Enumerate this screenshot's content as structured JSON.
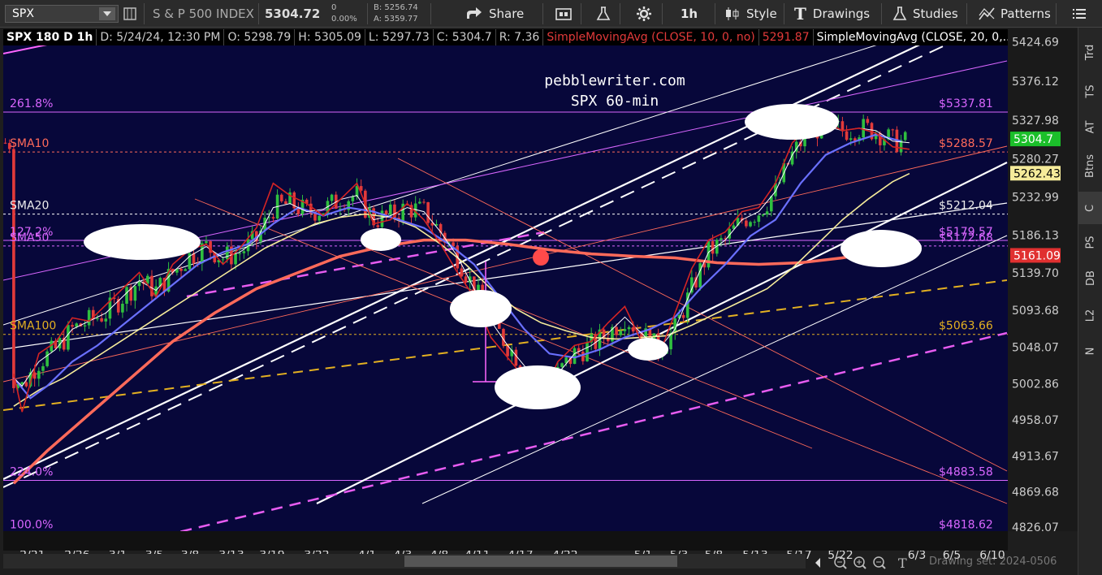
{
  "toolbar": {
    "symbol": "SPX",
    "name": "S & P 500 INDEX",
    "last": "5304.72",
    "change": "0",
    "change_pct": "0.00%",
    "bid": "B: 5256.74",
    "ask": "A: 5359.77",
    "share": "Share",
    "timeframe": "1h",
    "style": "Style",
    "drawings": "Drawings",
    "studies": "Studies",
    "patterns": "Patterns"
  },
  "info": {
    "period": "SPX 180 D 1h",
    "date": "D: 5/24/24, 12:30 PM",
    "open": "O: 5298.79",
    "high": "H: 5305.09",
    "low": "L: 5297.73",
    "close": "C: 5304.7",
    "range": "R: 7.36",
    "sma10_label": "SimpleMovingAvg (CLOSE, 10, 0, no)",
    "sma10_value": "5291.87",
    "sma20_label": "SimpleMovingAvg (CLOSE, 20, 0,..."
  },
  "colors": {
    "background": "#07073a",
    "up": "#2fbf3f",
    "down": "#e23a3a",
    "sma10": "#d42424",
    "sma20": "#ffffff",
    "sma50": "#6a70ff",
    "sma100": "#f5eb9a",
    "sma200": "#ff6a5a",
    "fib": "#d966ff",
    "yellow_dash": "#e3b021",
    "magenta_dash": "#e75cf0"
  },
  "right_tabs": [
    "Trd",
    "TS",
    "AT",
    "Btns",
    "C",
    "PS",
    "DB",
    "L2",
    "N"
  ],
  "bottom": {
    "drawing_set": "Drawing set: 2024-0506"
  },
  "chart_data": {
    "type": "candlestick",
    "title": "pebblewriter.com",
    "subtitle": "SPX 60-min",
    "x_ticks": [
      "2/21",
      "2/26",
      "3/1",
      "3/5",
      "3/8",
      "3/13",
      "3/19",
      "3/22",
      "4/1",
      "4/3",
      "4/8",
      "4/11",
      "4/17",
      "4/22",
      "5/1",
      "5/3",
      "5/8",
      "5/13",
      "5/17",
      "5/22",
      "6/3",
      "6/5",
      "6/10"
    ],
    "y_ticks": [
      5424.69,
      5376.12,
      5327.98,
      5280.27,
      5232.99,
      5186.13,
      5139.7,
      5093.68,
      5048.07,
      5002.86,
      4958.07,
      4913.67,
      4869.68,
      4826.07
    ],
    "ylim": [
      4821,
      5440
    ],
    "price_labels": [
      {
        "label": "5304.7",
        "value": 5304.7,
        "color": "#1bbf2a"
      },
      {
        "label": "5262.43",
        "value": 5262.43,
        "color": "#f5eb9a"
      },
      {
        "label": "5161.09",
        "value": 5161.09,
        "color": "#e03030"
      }
    ],
    "levels": [
      {
        "left": "261.8%",
        "right": "$5337.81",
        "value": 5337.81,
        "color": "#d966ff",
        "style": "solid"
      },
      {
        "left": "SMA10",
        "right": "$5288.57",
        "value": 5288.57,
        "color": "#ff6a5a",
        "style": "dotted"
      },
      {
        "left": "SMA20",
        "right": "$5212.04",
        "value": 5212.04,
        "color": "#ffffff",
        "style": "dotted"
      },
      {
        "left": "127.2%",
        "right": "$5179.57",
        "value": 5179.57,
        "color": "#d966ff",
        "style": "solid"
      },
      {
        "left": "SMA50",
        "right": "$5172.68",
        "value": 5172.68,
        "color": "#d966ff",
        "style": "dotted"
      },
      {
        "left": "SMA100",
        "right": "$5063.66",
        "value": 5063.66,
        "color": "#e3b021",
        "style": "dotted"
      },
      {
        "left": "224.0%",
        "right": "$4883.58",
        "value": 4883.58,
        "color": "#d966ff",
        "style": "solid"
      },
      {
        "left": "100.0%",
        "right": "$4818.62",
        "value": 4818.62,
        "color": "#d966ff",
        "style": "solid"
      }
    ],
    "sma10_points": [
      [
        2,
        5015
      ],
      [
        4,
        4968
      ],
      [
        8,
        5040
      ],
      [
        12,
        5054
      ],
      [
        16,
        5084
      ],
      [
        20,
        5080
      ],
      [
        24,
        5100
      ],
      [
        28,
        5120
      ],
      [
        32,
        5140
      ],
      [
        36,
        5110
      ],
      [
        40,
        5150
      ],
      [
        44,
        5168
      ],
      [
        48,
        5175
      ],
      [
        52,
        5150
      ],
      [
        56,
        5170
      ],
      [
        60,
        5195
      ],
      [
        64,
        5250
      ],
      [
        68,
        5235
      ],
      [
        72,
        5225
      ],
      [
        76,
        5210
      ],
      [
        80,
        5230
      ],
      [
        84,
        5250
      ],
      [
        88,
        5200
      ],
      [
        92,
        5205
      ],
      [
        96,
        5225
      ],
      [
        100,
        5205
      ],
      [
        104,
        5175
      ],
      [
        108,
        5140
      ],
      [
        112,
        5110
      ],
      [
        116,
        5060
      ],
      [
        120,
        5035
      ],
      [
        124,
        5010
      ],
      [
        128,
        4985
      ],
      [
        132,
        5030
      ],
      [
        136,
        5050
      ],
      [
        140,
        5055
      ],
      [
        144,
        5078
      ],
      [
        148,
        5098
      ],
      [
        152,
        5055
      ],
      [
        156,
        5035
      ],
      [
        160,
        5090
      ],
      [
        164,
        5145
      ],
      [
        168,
        5180
      ],
      [
        172,
        5190
      ],
      [
        176,
        5215
      ],
      [
        180,
        5220
      ],
      [
        184,
        5250
      ],
      [
        188,
        5300
      ],
      [
        192,
        5320
      ],
      [
        196,
        5325
      ],
      [
        200,
        5315
      ],
      [
        204,
        5318
      ],
      [
        208,
        5312
      ],
      [
        212,
        5295
      ],
      [
        216,
        5292
      ]
    ],
    "sma20_points": [
      [
        2,
        5010
      ],
      [
        4,
        5000
      ],
      [
        8,
        5030
      ],
      [
        12,
        5045
      ],
      [
        16,
        5070
      ],
      [
        20,
        5080
      ],
      [
        24,
        5090
      ],
      [
        28,
        5110
      ],
      [
        32,
        5130
      ],
      [
        36,
        5118
      ],
      [
        40,
        5140
      ],
      [
        44,
        5160
      ],
      [
        48,
        5172
      ],
      [
        52,
        5158
      ],
      [
        56,
        5165
      ],
      [
        60,
        5180
      ],
      [
        64,
        5220
      ],
      [
        68,
        5225
      ],
      [
        72,
        5215
      ],
      [
        76,
        5218
      ],
      [
        80,
        5230
      ],
      [
        84,
        5235
      ],
      [
        88,
        5205
      ],
      [
        92,
        5210
      ],
      [
        96,
        5220
      ],
      [
        100,
        5215
      ],
      [
        104,
        5190
      ],
      [
        108,
        5160
      ],
      [
        112,
        5120
      ],
      [
        116,
        5080
      ],
      [
        120,
        5050
      ],
      [
        124,
        5025
      ],
      [
        128,
        5005
      ],
      [
        132,
        5015
      ],
      [
        136,
        5040
      ],
      [
        140,
        5050
      ],
      [
        144,
        5065
      ],
      [
        148,
        5085
      ],
      [
        152,
        5065
      ],
      [
        156,
        5045
      ],
      [
        160,
        5070
      ],
      [
        164,
        5120
      ],
      [
        168,
        5165
      ],
      [
        172,
        5180
      ],
      [
        176,
        5205
      ],
      [
        180,
        5215
      ],
      [
        184,
        5240
      ],
      [
        188,
        5285
      ],
      [
        192,
        5315
      ],
      [
        196,
        5320
      ],
      [
        200,
        5315
      ],
      [
        204,
        5318
      ],
      [
        208,
        5315
      ],
      [
        212,
        5302
      ],
      [
        216,
        5300
      ]
    ],
    "sma50_points": [
      [
        2,
        5010
      ],
      [
        6,
        4985
      ],
      [
        10,
        5000
      ],
      [
        16,
        5030
      ],
      [
        22,
        5050
      ],
      [
        28,
        5075
      ],
      [
        34,
        5100
      ],
      [
        40,
        5125
      ],
      [
        46,
        5150
      ],
      [
        52,
        5165
      ],
      [
        58,
        5175
      ],
      [
        64,
        5200
      ],
      [
        70,
        5220
      ],
      [
        76,
        5210
      ],
      [
        82,
        5220
      ],
      [
        88,
        5215
      ],
      [
        94,
        5205
      ],
      [
        100,
        5195
      ],
      [
        106,
        5175
      ],
      [
        112,
        5150
      ],
      [
        118,
        5110
      ],
      [
        124,
        5070
      ],
      [
        130,
        5040
      ],
      [
        136,
        5035
      ],
      [
        142,
        5045
      ],
      [
        148,
        5060
      ],
      [
        154,
        5070
      ],
      [
        160,
        5085
      ],
      [
        166,
        5120
      ],
      [
        172,
        5150
      ],
      [
        178,
        5185
      ],
      [
        184,
        5205
      ],
      [
        190,
        5250
      ],
      [
        196,
        5285
      ],
      [
        202,
        5300
      ],
      [
        208,
        5310
      ],
      [
        214,
        5302
      ]
    ],
    "sma100_points": [
      [
        2,
        4975
      ],
      [
        8,
        4995
      ],
      [
        14,
        5010
      ],
      [
        20,
        5030
      ],
      [
        26,
        5050
      ],
      [
        32,
        5070
      ],
      [
        38,
        5090
      ],
      [
        44,
        5110
      ],
      [
        50,
        5130
      ],
      [
        56,
        5150
      ],
      [
        62,
        5170
      ],
      [
        68,
        5185
      ],
      [
        74,
        5200
      ],
      [
        80,
        5208
      ],
      [
        86,
        5212
      ],
      [
        92,
        5208
      ],
      [
        98,
        5196
      ],
      [
        104,
        5175
      ],
      [
        110,
        5150
      ],
      [
        116,
        5120
      ],
      [
        122,
        5095
      ],
      [
        128,
        5078
      ],
      [
        134,
        5068
      ],
      [
        140,
        5060
      ],
      [
        146,
        5058
      ],
      [
        152,
        5060
      ],
      [
        158,
        5062
      ],
      [
        164,
        5075
      ],
      [
        170,
        5090
      ],
      [
        176,
        5105
      ],
      [
        182,
        5120
      ],
      [
        188,
        5145
      ],
      [
        194,
        5175
      ],
      [
        200,
        5205
      ],
      [
        206,
        5230
      ],
      [
        212,
        5252
      ],
      [
        216,
        5262
      ]
    ],
    "sma200_points": [
      [
        2,
        4880
      ],
      [
        10,
        4920
      ],
      [
        20,
        4965
      ],
      [
        30,
        5010
      ],
      [
        40,
        5055
      ],
      [
        50,
        5090
      ],
      [
        60,
        5120
      ],
      [
        70,
        5140
      ],
      [
        80,
        5160
      ],
      [
        90,
        5172
      ],
      [
        100,
        5180
      ],
      [
        110,
        5180
      ],
      [
        120,
        5175
      ],
      [
        130,
        5168
      ],
      [
        140,
        5163
      ],
      [
        150,
        5160
      ],
      [
        160,
        5158
      ],
      [
        170,
        5152
      ],
      [
        180,
        5150
      ],
      [
        190,
        5152
      ],
      [
        200,
        5158
      ],
      [
        210,
        5168
      ],
      [
        216,
        5178
      ]
    ]
  }
}
